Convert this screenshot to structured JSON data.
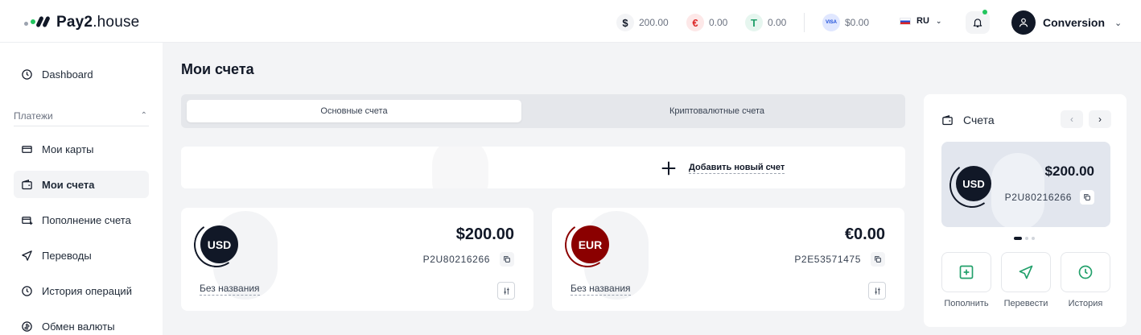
{
  "brand": {
    "name_bold": "Pay2",
    "name_rest": ".house"
  },
  "header": {
    "balances": [
      {
        "symbol": "$",
        "amount": "200.00"
      },
      {
        "symbol": "€",
        "amount": "0.00"
      },
      {
        "symbol": "T",
        "amount": "0.00"
      },
      {
        "symbol": "VISA",
        "amount": "$0.00"
      }
    ],
    "language": "RU",
    "user_name": "Conversion"
  },
  "sidebar": {
    "dashboard": "Dashboard",
    "group_label": "Платежи",
    "items": [
      {
        "label": "Мои карты"
      },
      {
        "label": "Мои счета"
      },
      {
        "label": "Пополнение счета"
      },
      {
        "label": "Переводы"
      },
      {
        "label": "История операций"
      },
      {
        "label": "Обмен валюты"
      }
    ]
  },
  "main": {
    "title": "Мои счета",
    "tabs": [
      {
        "label": "Основные счета"
      },
      {
        "label": "Криптовалютные счета"
      }
    ],
    "add_account_label": "Добавить новый счет",
    "accounts": [
      {
        "currency": "USD",
        "amount": "$200.00",
        "number": "P2U80216266",
        "name": "Без названия",
        "color": "#111827"
      },
      {
        "currency": "EUR",
        "amount": "€0.00",
        "number": "P2E53571475",
        "name": "Без названия",
        "color": "#8b0000"
      }
    ]
  },
  "panel": {
    "title": "Счета",
    "card": {
      "currency": "USD",
      "amount": "$200.00",
      "number": "P2U80216266"
    },
    "actions": [
      {
        "label": "Пополнить"
      },
      {
        "label": "Перевести"
      },
      {
        "label": "История"
      }
    ]
  },
  "colors": {
    "accent_green": "#22a06b",
    "usd_dark": "#111827",
    "eur_red": "#8b0000",
    "notification_dot": "#22c55e"
  }
}
